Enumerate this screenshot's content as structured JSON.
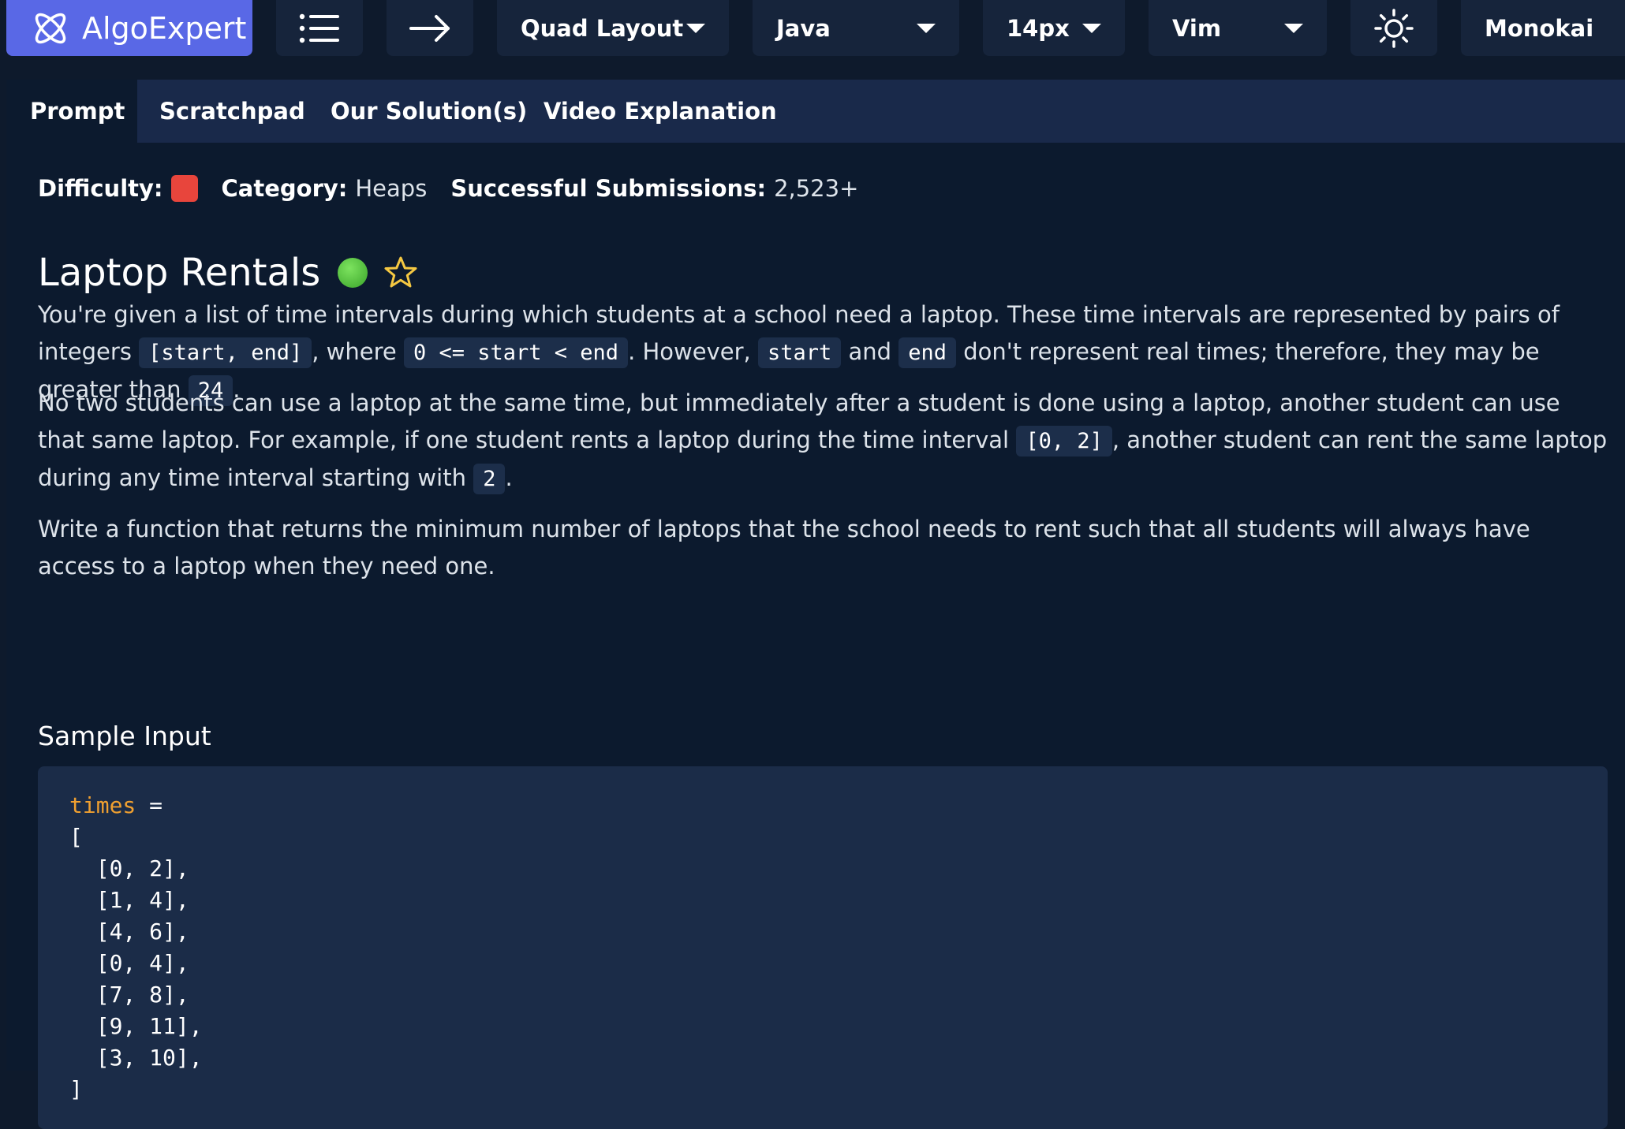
{
  "toolbar": {
    "brand": "AlgoExpert",
    "layout": "Quad Layout",
    "language": "Java",
    "font_size": "14px",
    "keymap": "Vim",
    "theme": "Monokai"
  },
  "tabs": [
    "Prompt",
    "Scratchpad",
    "Our Solution(s)",
    "Video Explanation"
  ],
  "meta": {
    "difficulty_label": "Difficulty:",
    "category_label": "Category:",
    "category": "Heaps",
    "submissions_label": "Successful Submissions:",
    "submissions": "2,523+"
  },
  "problem": {
    "title": "Laptop Rentals",
    "p1_a": "You're given a list of time intervals during which students at a school need a laptop. These time intervals are represented by pairs of integers ",
    "p1_code1": "[start, end]",
    "p1_b": ", where ",
    "p1_code2": "0 <= start < end",
    "p1_c": ". However, ",
    "p1_code3": "start",
    "p1_d": " and ",
    "p1_code4": "end",
    "p1_e": " don't represent real times; therefore, they may be greater than ",
    "p1_code5": "24",
    "p1_f": ".",
    "p2_a": "No two students can use a laptop at the same time, but immediately after a student is done using a laptop, another student can use that same laptop. For example, if one student rents a laptop during the time interval ",
    "p2_code1": "[0, 2]",
    "p2_b": ", another student can rent the same laptop during any time interval starting with ",
    "p2_code2": "2",
    "p2_c": ".",
    "p3": "Write a function that returns the minimum number of laptops that the school needs to rent such that all students will always have access to a laptop when they need one.",
    "sample_heading": "Sample Input",
    "sample_var": "times",
    "sample_eq": " =",
    "sample_open": "[",
    "sample_rows": [
      "  [0, 2],",
      "  [1, 4],",
      "  [4, 6],",
      "  [0, 4],",
      "  [7, 8],",
      "  [9, 11],",
      "  [3, 10],"
    ],
    "sample_close": "]"
  },
  "colors": {
    "brand": "#5968e6",
    "difficulty_hard": "#e8453c",
    "completed": "#4cc13a",
    "star": "#f5c842",
    "keyword": "#f0a030"
  },
  "icons": [
    "algoexpert-logo-icon",
    "list-icon",
    "arrow-right-icon",
    "caret-down-icon",
    "sun-icon",
    "status-dot-icon",
    "star-icon"
  ]
}
